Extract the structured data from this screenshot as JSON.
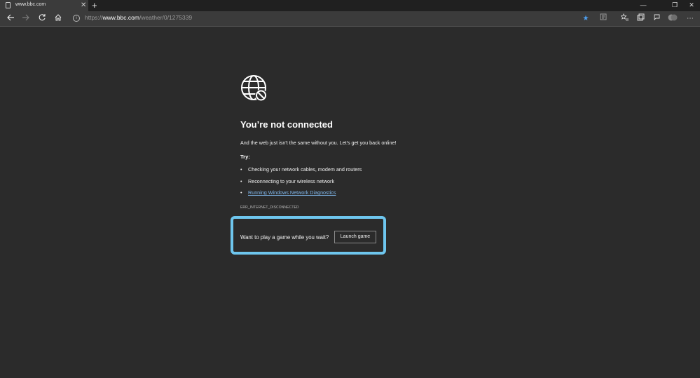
{
  "tab": {
    "title": "www.bbc.com",
    "close_glyph": "✕",
    "new_tab_glyph": "+"
  },
  "window_controls": {
    "minimize": "—",
    "maximize": "❐",
    "close": "✕"
  },
  "address_bar": {
    "prefix": "https://",
    "host": "www.bbc.com",
    "path": "/weather/0/1275339"
  },
  "error_page": {
    "title": "You’re not connected",
    "description": "And the web just isn't the same without you. Let's get you back online!",
    "try_label": "Try:",
    "tips": [
      "Checking your network cables, modem and routers",
      "Reconnecting to your wireless network",
      "Running Windows Network Diagnostics"
    ],
    "error_code": "ERR_INTERNET_DISCONNECTED",
    "game_prompt": "Want to play a game while you wait?",
    "launch_button": "Launch game"
  },
  "colors": {
    "background": "#2b2b2b",
    "toolbar": "#3b3b3b",
    "link": "#7fb6ea",
    "highlight": "#6ec6ee",
    "favorite_star": "#4ea1f3"
  }
}
